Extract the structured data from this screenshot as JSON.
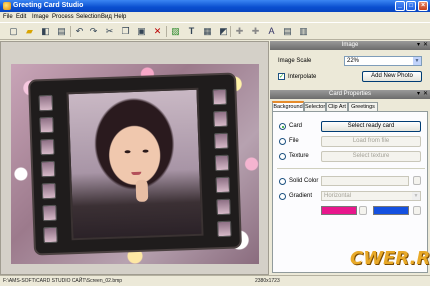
{
  "window": {
    "title": "Greeting Card Studio",
    "min": "_",
    "max": "□",
    "close": "×"
  },
  "menu": [
    "File",
    "Edit",
    "Image",
    "Process",
    "Selection",
    "Вид",
    "Help"
  ],
  "toolbar_icons": [
    "new-icon",
    "open-icon",
    "save-icon",
    "print-icon",
    "undo-icon",
    "redo-icon",
    "cut-icon",
    "copy-icon",
    "paste-icon",
    "delete-icon",
    "image-icon",
    "text-icon",
    "frame-icon",
    "effect-icon",
    "add-icon",
    "move-icon",
    "font-icon",
    "align-icon",
    "layers-icon"
  ],
  "image_panel": {
    "header": "Image",
    "scale_label": "Image Scale",
    "scale_value": "22%",
    "interpolate_label": "Interpolate",
    "add_photo": "Add New Photo"
  },
  "props_panel": {
    "header": "Card Properties",
    "tabs": [
      "Background",
      "Selector",
      "Clip Art",
      "Greetings"
    ],
    "card_label": "Card",
    "card_btn": "Select ready card",
    "file_label": "File",
    "file_btn": "Load from file",
    "texture_label": "Texture",
    "texture_btn": "Select texture",
    "solid_label": "Solid Color",
    "gradient_label": "Gradient",
    "gradient_value": "Horizontal",
    "colors": {
      "swatch1": "#e8168c",
      "swatch2": "#1450e0"
    }
  },
  "status": {
    "path": "F:\\AMS-SOFT\\CARD STUDIO САЙТ\\Screen_02.bmp",
    "size": "2380x1723"
  },
  "watermark": "CWER.RU"
}
